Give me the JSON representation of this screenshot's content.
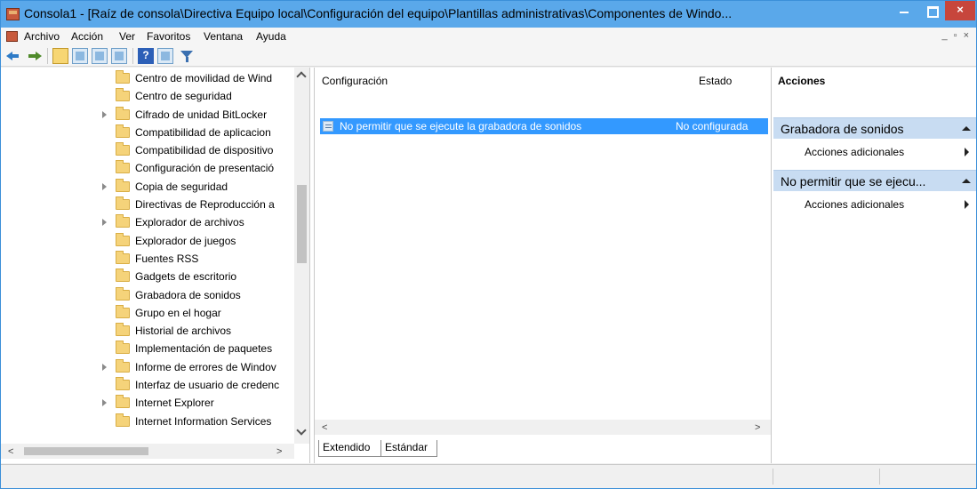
{
  "window": {
    "title": "Consola1 - [Raíz de consola\\Directiva Equipo local\\Configuración del equipo\\Plantillas administrativas\\Componentes de Windo..."
  },
  "menu": [
    "Archivo",
    "Acción",
    "Ver",
    "Favoritos",
    "Ventana",
    "Ayuda"
  ],
  "tree": {
    "items": [
      {
        "label": "Centro de movilidad de Wind",
        "expandable": false
      },
      {
        "label": "Centro de seguridad",
        "expandable": false
      },
      {
        "label": "Cifrado de unidad BitLocker",
        "expandable": true
      },
      {
        "label": "Compatibilidad de aplicacion",
        "expandable": false
      },
      {
        "label": "Compatibilidad de dispositivo",
        "expandable": false
      },
      {
        "label": "Configuración de presentació",
        "expandable": false
      },
      {
        "label": "Copia de seguridad",
        "expandable": true
      },
      {
        "label": "Directivas de Reproducción a",
        "expandable": false
      },
      {
        "label": "Explorador de archivos",
        "expandable": true
      },
      {
        "label": "Explorador de juegos",
        "expandable": false
      },
      {
        "label": "Fuentes RSS",
        "expandable": false
      },
      {
        "label": "Gadgets de escritorio",
        "expandable": false
      },
      {
        "label": "Grabadora de sonidos",
        "expandable": false
      },
      {
        "label": "Grupo en el hogar",
        "expandable": false
      },
      {
        "label": "Historial de archivos",
        "expandable": false
      },
      {
        "label": "Implementación de paquetes",
        "expandable": false
      },
      {
        "label": "Informe de errores de Windov",
        "expandable": true
      },
      {
        "label": "Interfaz de usuario de credenc",
        "expandable": false
      },
      {
        "label": "Internet Explorer",
        "expandable": true
      },
      {
        "label": "Internet Information Services",
        "expandable": false
      }
    ]
  },
  "details": {
    "columns": {
      "name": "Configuración",
      "state": "Estado"
    },
    "rows": [
      {
        "name": "No permitir que se ejecute la grabadora de sonidos",
        "state": "No configurada"
      }
    ],
    "tabs": [
      "Extendido",
      "Estándar"
    ]
  },
  "actions": {
    "title": "Acciones",
    "sections": [
      {
        "header": "Grabadora de sonidos",
        "item": "Acciones adicionales"
      },
      {
        "header": "No permitir que se ejecu...",
        "item": "Acciones adicionales"
      }
    ]
  },
  "colors": {
    "titlebar": "#5aa8ea",
    "selection": "#3399ff",
    "action_header": "#c8dcf2",
    "close_button": "#c7463c"
  }
}
